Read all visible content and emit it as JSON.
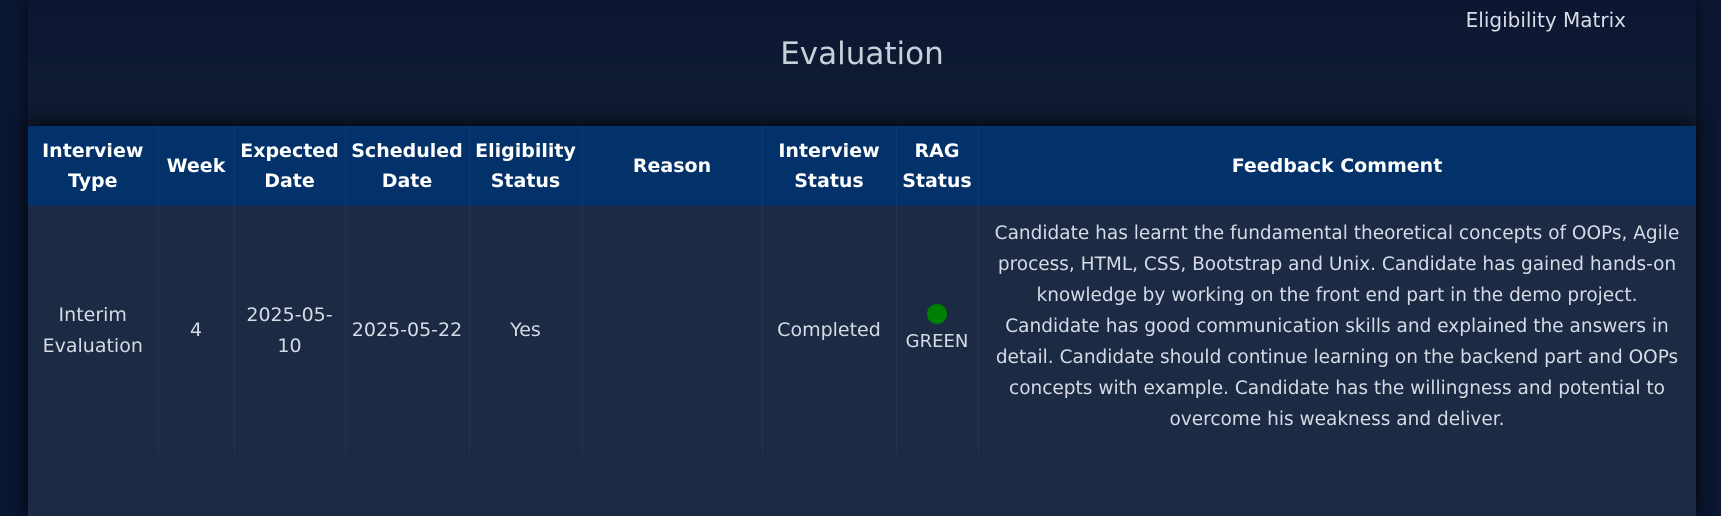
{
  "header": {
    "matrix_link": "Eligibility Matrix",
    "title": "Evaluation"
  },
  "table": {
    "columns": [
      "Interview Type",
      "Week",
      "Expected Date",
      "Scheduled Date",
      "Eligibility Status",
      "Reason",
      "Interview Status",
      "RAG Status",
      "Feedback Comment"
    ],
    "rows": [
      {
        "interview_type": "Interim Evaluation",
        "week": "4",
        "expected_date": "2025-05-10",
        "scheduled_date": "2025-05-22",
        "eligibility_status": "Yes",
        "reason": "",
        "interview_status": "Completed",
        "rag_status": "GREEN",
        "rag_color": "#008000",
        "feedback_comment": "Candidate has learnt the fundamental theoretical concepts of OOPs, Agile process, HTML, CSS, Bootstrap and Unix. Candidate has gained hands-on knowledge by working on the front end part in the demo project. Candidate has good communication skills and explained the answers in detail. Candidate should continue learning on the backend part and OOPs concepts with example. Candidate has the willingness and potential to overcome his weakness and deliver."
      }
    ]
  },
  "colors": {
    "background": "#0b1730",
    "header_bg": "#03326b",
    "row_bg": "#1d2a44",
    "rag_green": "#008000"
  }
}
